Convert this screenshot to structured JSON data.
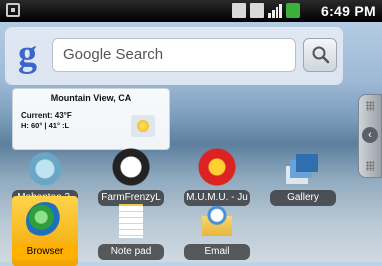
{
  "status_bar": {
    "time": "6:49 PM",
    "icons": [
      "sim-card-icon",
      "data-transfer-icon",
      "signal-strength-icon",
      "battery-icon"
    ]
  },
  "search_widget": {
    "logo": "g",
    "placeholder": "Google Search",
    "button_icon": "magnifier-icon"
  },
  "weather_widget": {
    "city": "Mountain View, CA",
    "current": "Current: 43°F",
    "high_low": "H: 60° | 41° :L",
    "condition_icon": "sunny-icon"
  },
  "drawer_handle": {
    "icon": "chevron-left-icon",
    "glyph": "‹"
  },
  "apps": [
    {
      "label": "Mobentoo 3.",
      "icon": "mobentoo-icon"
    },
    {
      "label": "FarmFrenzyL",
      "icon": "farm-frenzy-icon"
    },
    {
      "label": "M.U.M.U. - Ju",
      "icon": "mumu-icon"
    },
    {
      "label": "Gallery",
      "icon": "gallery-icon"
    },
    {
      "label": "Browser",
      "icon": "browser-icon",
      "selected": true
    },
    {
      "label": "Note pad",
      "icon": "notepad-icon"
    },
    {
      "label": "Email",
      "icon": "email-icon"
    }
  ],
  "colors": {
    "selected_accent": "#ffb000",
    "status_bar_bg": "#000000",
    "google_blue": "#3a66c9"
  }
}
